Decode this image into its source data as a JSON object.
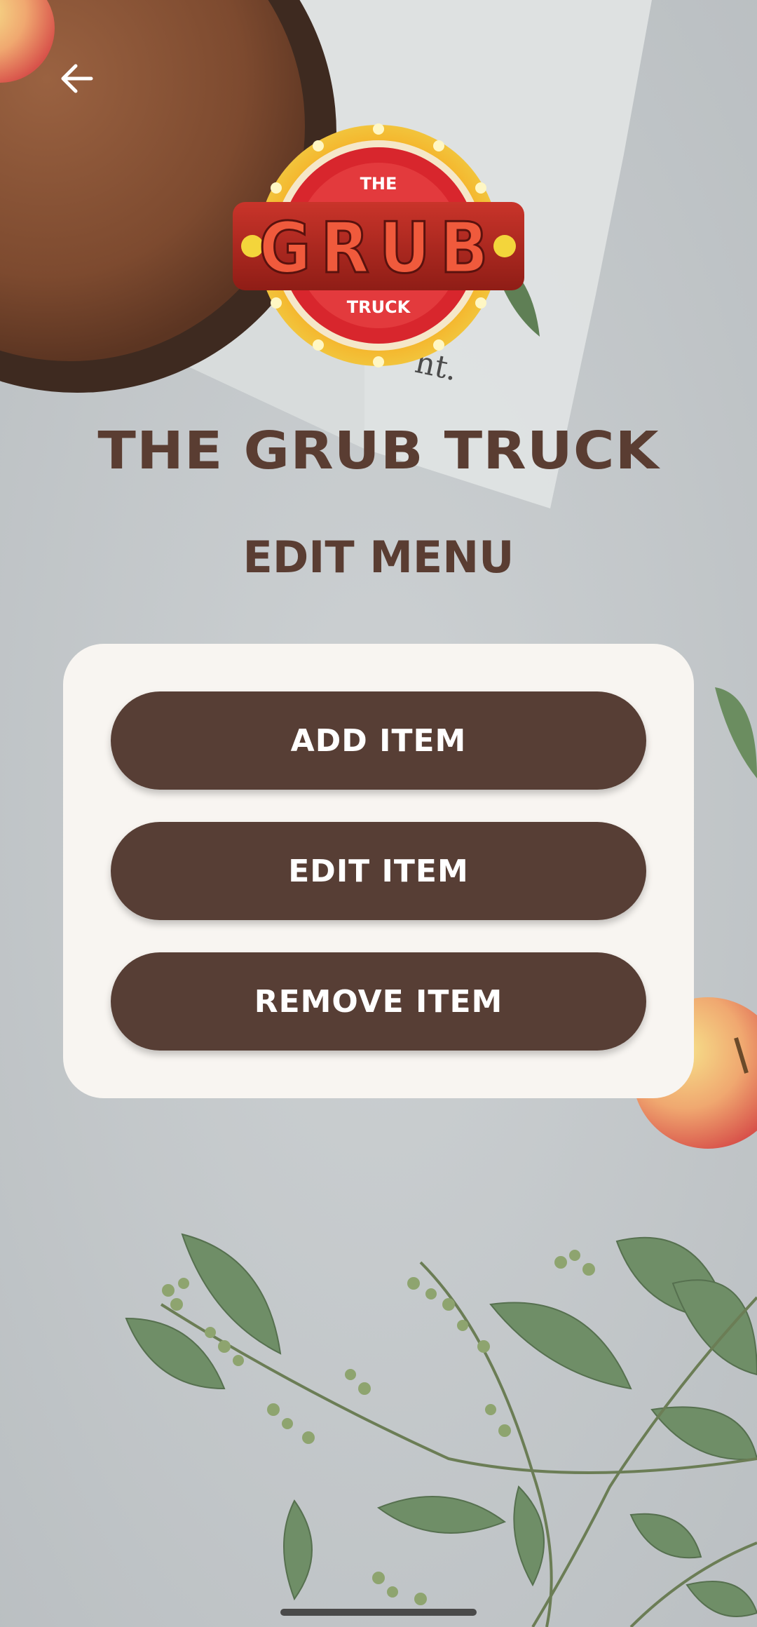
{
  "header": {
    "back_icon": "arrow-left-icon",
    "logo": {
      "top_text": "THE",
      "main_text": "GRUB",
      "bottom_text": "TRUCK"
    },
    "app_title": "THE GRUB TRUCK",
    "page_title": "EDIT MENU"
  },
  "menu": {
    "buttons": [
      {
        "label": "ADD ITEM"
      },
      {
        "label": "EDIT ITEM"
      },
      {
        "label": "REMOVE ITEM"
      }
    ]
  },
  "background": {
    "cloth_text": "nt."
  },
  "colors": {
    "brand_brown": "#573e35",
    "title_brown": "#5a3d32",
    "card_bg": "#f8f5f1",
    "logo_red": "#d8262d",
    "logo_gold": "#f5b51c"
  }
}
